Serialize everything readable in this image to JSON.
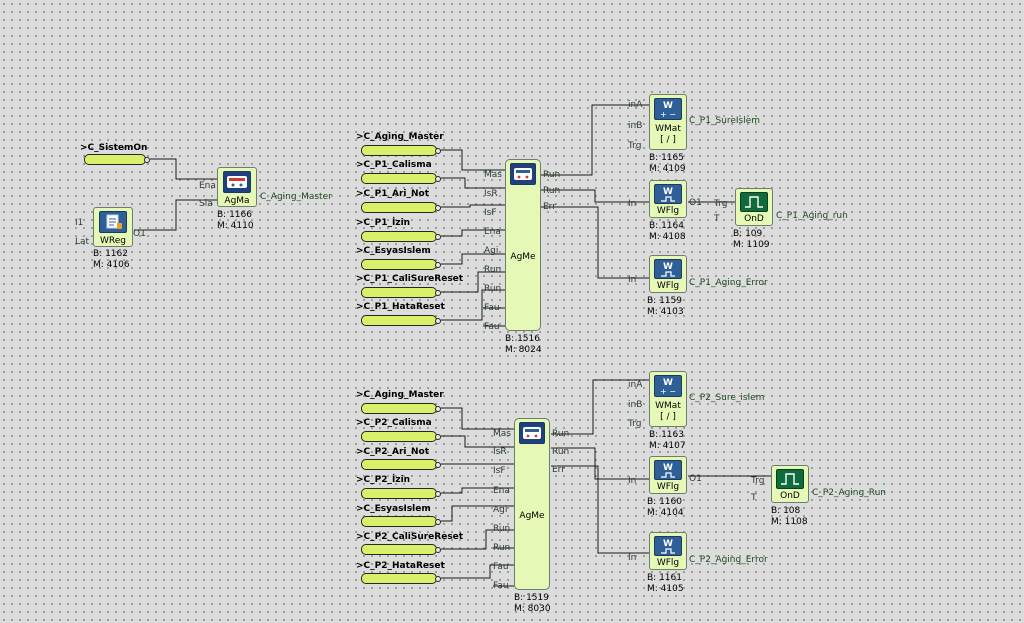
{
  "inputs": {
    "sistem_on": "C_SistemOn",
    "aging_master_1": "C_Aging_Master",
    "p1_calisma": "C_P1_Calisma",
    "p1_ari_not": "C_P1_Ari_Not",
    "p1_izin": "C_P1_İzin",
    "esyasislem_1": "C_EsyasIslem",
    "p1_cali_sure_reset": "C_P1_CaliSureReset",
    "p1_hata_reset": "C_P1_HataReset",
    "aging_master_2": "C_Aging_Master",
    "p2_calisma": "C_P2_Calisma",
    "p2_ari_not": "C_P2_Ari_Not",
    "p2_izin": "C_P2_İzin",
    "esyasislem_2": "C_EsyasIslem",
    "p2_cali_sure_reset": "C_P2_CaliSureReset",
    "p2_hata_reset": "C_P2_HataReset"
  },
  "blocks": {
    "wreg": {
      "name": "WReg",
      "pin_i1": "I1",
      "pin_lat": "Lat",
      "pin_o1": "O1",
      "b": "B: 1162",
      "m": "M: 4106"
    },
    "agma": {
      "name": "AgMa",
      "pin_ena": "Ena",
      "pin_sla": "Sla",
      "b": "B: 1166",
      "m": "M: 4110",
      "output": "C_Aging_Master"
    },
    "agme1": {
      "name": "AgMe",
      "in_pins": [
        "Mas",
        "IsR",
        "IsF",
        "Ena",
        "Agi",
        "Run",
        "Run",
        "Fau",
        "Fau"
      ],
      "out_pins": [
        "Run",
        "Run",
        "Err"
      ],
      "b": "B: 1516",
      "m": "M: 8024"
    },
    "agme2": {
      "name": "AgMe",
      "in_pins": [
        "Mas",
        "IsR",
        "IsF",
        "Ena",
        "Agi",
        "Run",
        "Run",
        "Fau",
        "Fau"
      ],
      "out_pins": [
        "Run",
        "Run",
        "Err"
      ],
      "b": "B: 1519",
      "m": "M: 8030"
    },
    "wmat1": {
      "name": "WMat",
      "sub": "[ / ]",
      "pin_ina": "inA",
      "pin_inb": "inB",
      "pin_trg": "Trg",
      "b": "B: 1165",
      "m": "M: 4109",
      "output": "C_P1_SureIslem"
    },
    "wflg1": {
      "name": "WFlg",
      "pin_in": "In",
      "pin_o1": "O1",
      "b": "B: 1164",
      "m": "M: 4108"
    },
    "ond1": {
      "name": "OnD",
      "pin_trg": "Trg",
      "pin_t": "T",
      "b": "B: 109",
      "m": "M: 1109",
      "output": "C_P1_Aging_run"
    },
    "wflg1e": {
      "name": "WFlg",
      "pin_in": "In",
      "b": "B: 1159",
      "m": "M: 4103",
      "output": "C_P1_Aging_Error"
    },
    "wmat2": {
      "name": "WMat",
      "sub": "[ / ]",
      "pin_ina": "inA",
      "pin_inb": "inB",
      "pin_trg": "Trg",
      "b": "B: 1163",
      "m": "M: 4107",
      "output": "C_P2_Sure_islem"
    },
    "wflg2": {
      "name": "WFlg",
      "pin_in": "In",
      "pin_o1": "O1",
      "b": "B: 1160",
      "m": "M: 4104"
    },
    "ond2": {
      "name": "OnD",
      "pin_trg": "Trg",
      "pin_t": "T",
      "b": "B: 108",
      "m": "M: 1108",
      "output": "C_P2_Aging_Run"
    },
    "wflg2e": {
      "name": "WFlg",
      "pin_in": "In",
      "b": "B: 1161",
      "m": "M: 4105",
      "output": "C_P2_Aging_Error"
    }
  },
  "colors": {
    "canvas": "#dcdcdc",
    "block_fill": "#e6f8b6",
    "input_pin_fill": "#d9f06b",
    "wire": "#1a1a1a",
    "icon_blue": "#2f5f97",
    "icon_green": "#0f6b3c"
  }
}
